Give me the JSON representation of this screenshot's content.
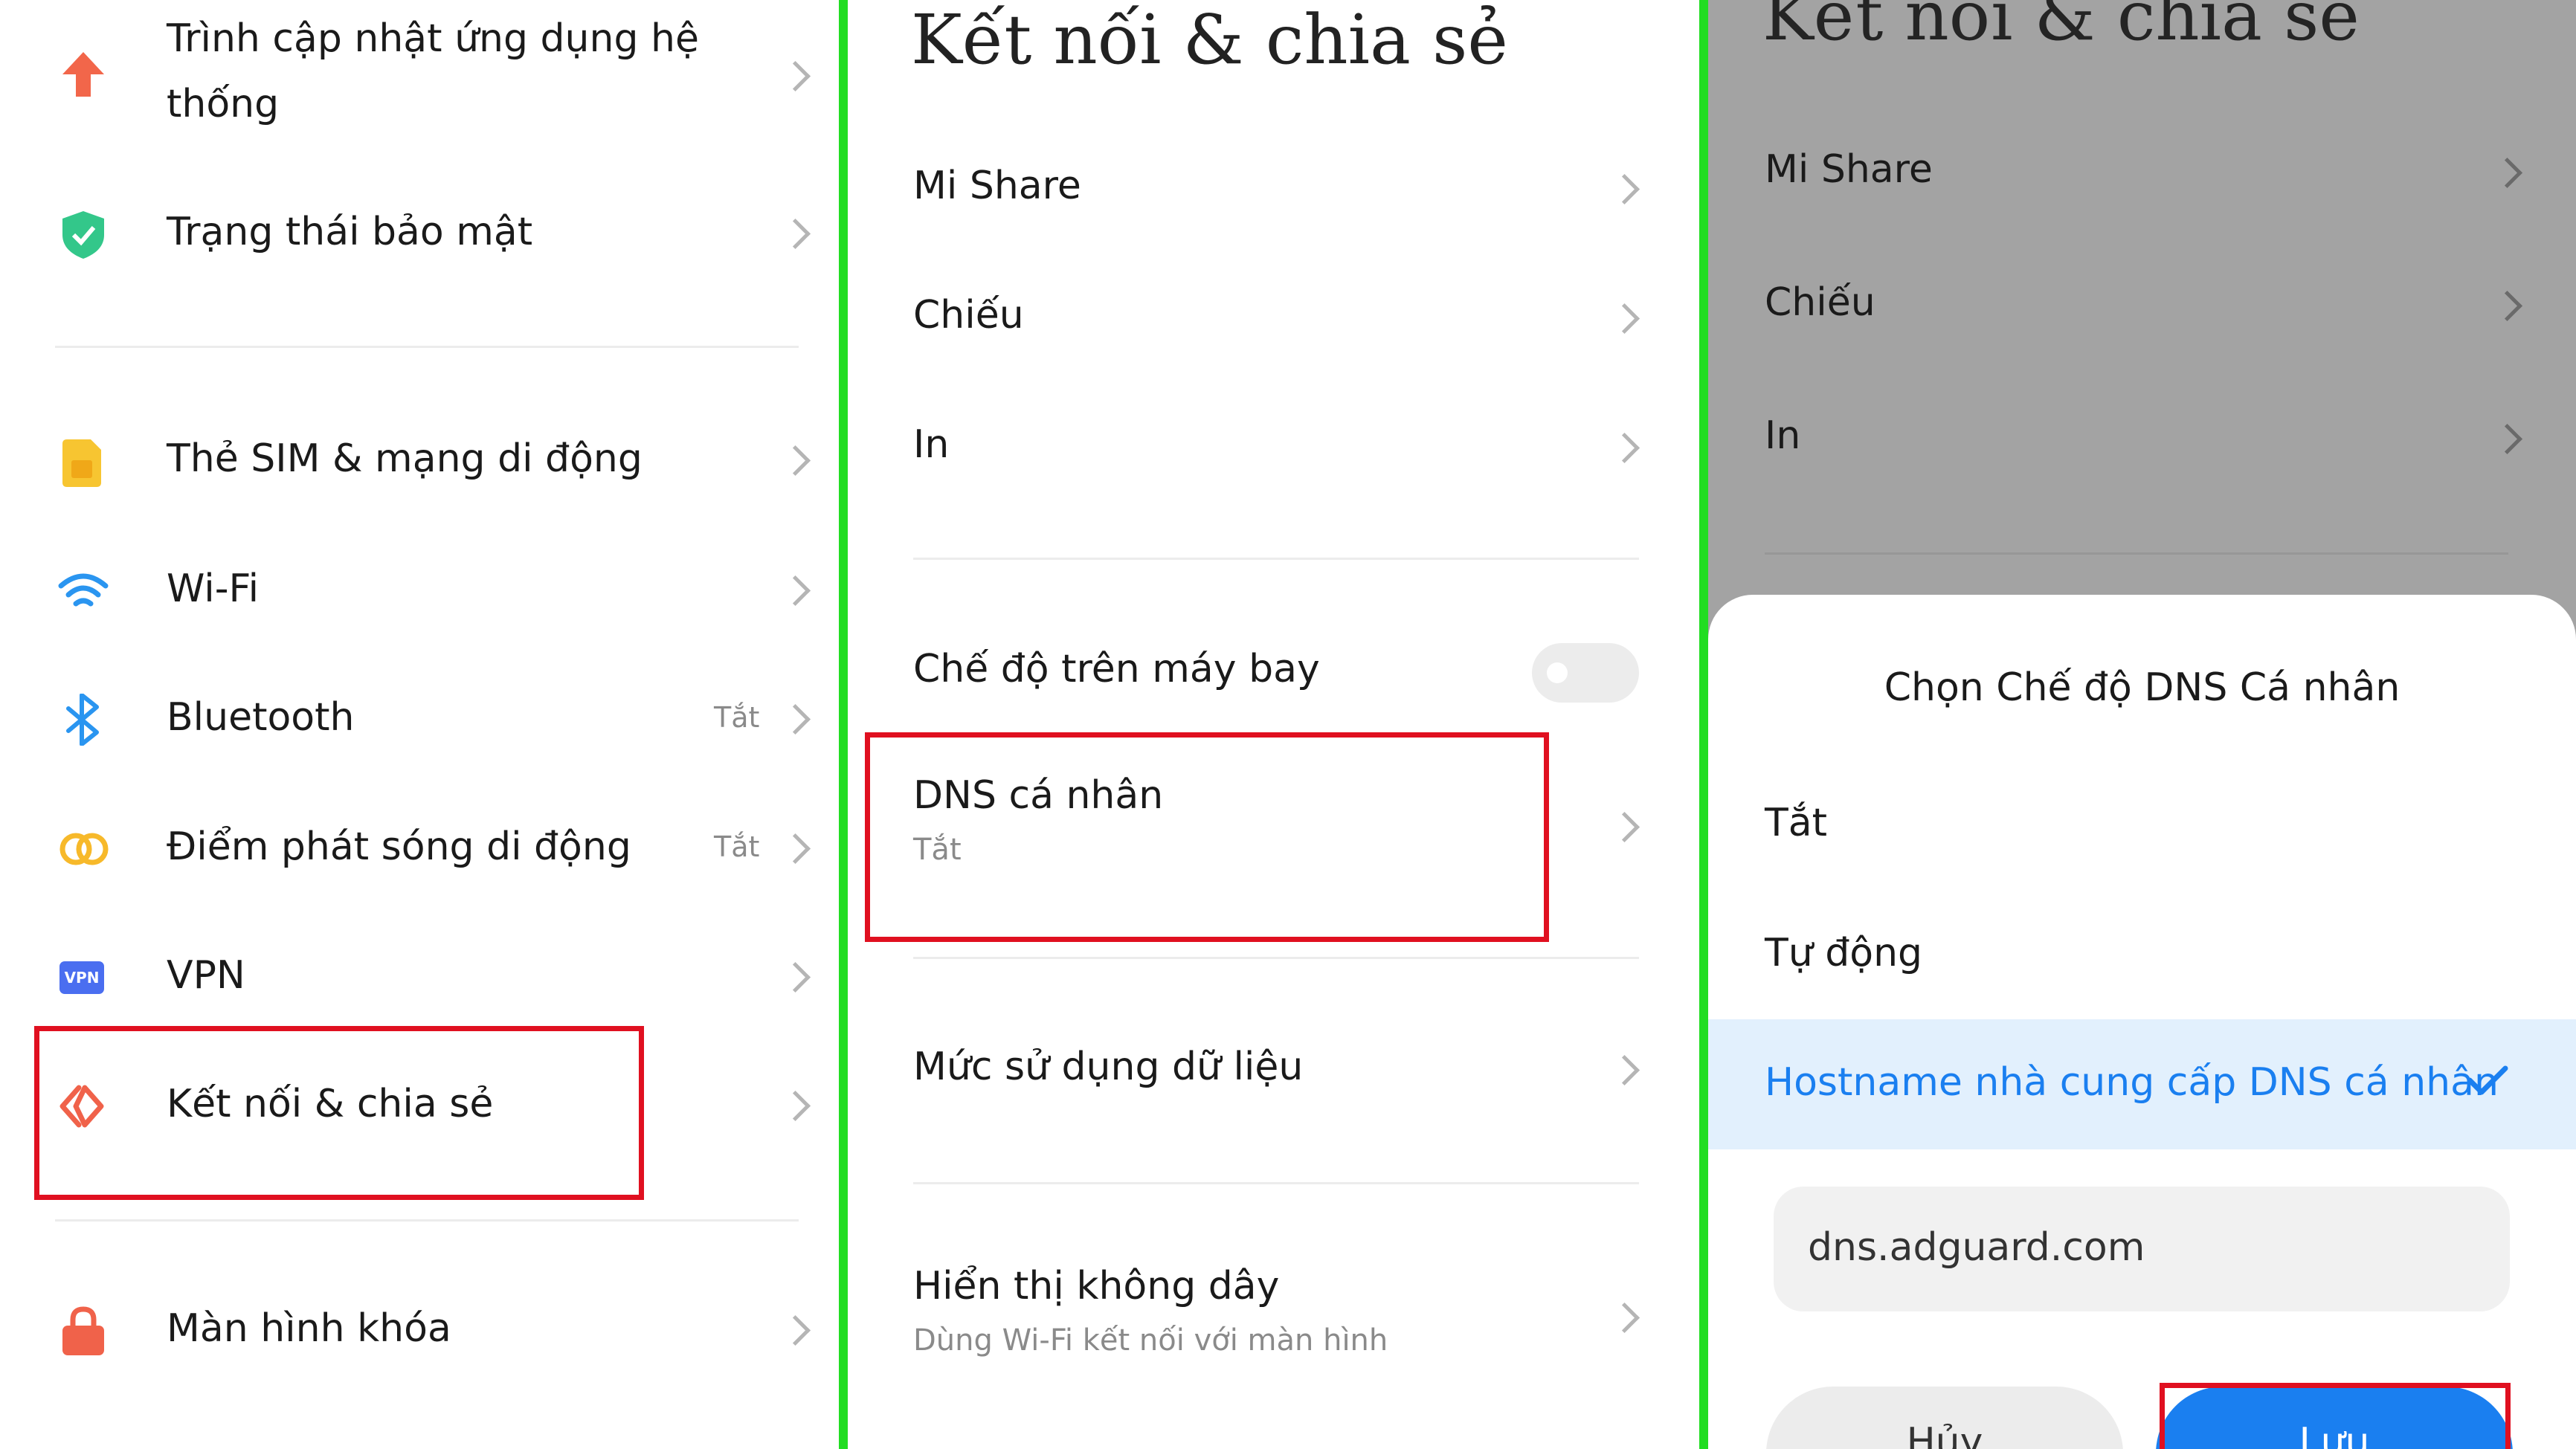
{
  "left": {
    "items": [
      {
        "label_line1": "Trình cập nhật ứng dụng hệ",
        "label_line2": "thống",
        "icon": "arrow-up-icon"
      },
      {
        "label": "Trạng thái bảo mật",
        "icon": "shield-check-icon"
      },
      {
        "label": "Thẻ SIM & mạng di động",
        "icon": "sim-card-icon"
      },
      {
        "label": "Wi-Fi",
        "icon": "wifi-icon"
      },
      {
        "label": "Bluetooth",
        "state": "Tắt",
        "icon": "bluetooth-icon"
      },
      {
        "label": "Điểm phát sóng di động",
        "state": "Tắt",
        "icon": "hotspot-icon"
      },
      {
        "label": "VPN",
        "icon": "vpn-icon",
        "icon_text": "VPN"
      },
      {
        "label": "Kết nối & chia sẻ",
        "icon": "share-connect-icon"
      },
      {
        "label": "Màn hình khóa",
        "icon": "lock-icon"
      }
    ]
  },
  "middle": {
    "title": "Kết nối & chia sẻ",
    "items": [
      {
        "label": "Mi Share"
      },
      {
        "label": "Chiếu"
      },
      {
        "label": "In"
      },
      {
        "label": "Chế độ trên máy bay"
      },
      {
        "label": "DNS cá nhân",
        "sub": "Tắt"
      },
      {
        "label": "Mức sử dụng dữ liệu"
      },
      {
        "label": "Hiển thị không dây",
        "sub": "Dùng Wi-Fi kết nối với màn hình"
      }
    ]
  },
  "right": {
    "title": "Kết nối & chia sẻ",
    "items": [
      {
        "label": "Mi Share"
      },
      {
        "label": "Chiếu"
      },
      {
        "label": "In"
      }
    ],
    "dialog": {
      "title": "Chọn Chế độ DNS Cá nhân",
      "options": [
        "Tắt",
        "Tự động",
        "Hostname nhà cung cấp DNS cá nhân"
      ],
      "selected_index": 2,
      "input_value": "dns.adguard.com",
      "cancel_label": "Hủy",
      "save_label": "Lưu"
    }
  },
  "colors": {
    "accent": "#1a7ff0",
    "highlight": "#e2f0fd",
    "red_box": "#e01020",
    "divider": "#22dd22"
  }
}
